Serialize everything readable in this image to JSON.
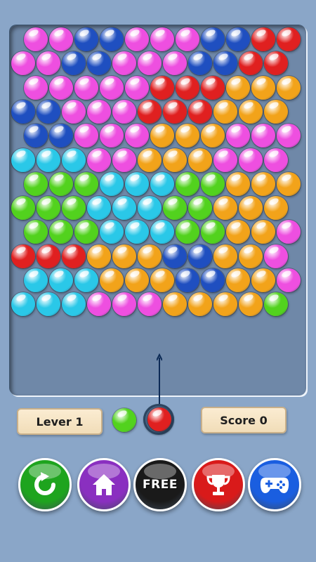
{
  "status_bar": {
    "level_label": "Lever 1",
    "score_label": "Score 0"
  },
  "colors": {
    "pink": "#ee4fe0",
    "blue": "#1f4fc0",
    "red": "#e02020",
    "orange": "#f2a31a",
    "cyan": "#2ac8e8",
    "green": "#52d21e",
    "background": "#8aa6c8",
    "board": "#6f88a8"
  },
  "board": {
    "rows": [
      [
        "P",
        "P",
        "B",
        "B",
        "P",
        "P",
        "P",
        "B",
        "B",
        "R",
        "R"
      ],
      [
        "P",
        "P",
        "B",
        "B",
        "P",
        "P",
        "P",
        "B",
        "B",
        "R",
        "R"
      ],
      [
        "P",
        "P",
        "P",
        "P",
        "P",
        "R",
        "R",
        "R",
        "O",
        "O",
        "O"
      ],
      [
        "B",
        "B",
        "P",
        "P",
        "P",
        "R",
        "R",
        "R",
        "O",
        "O",
        "O"
      ],
      [
        "B",
        "B",
        "P",
        "P",
        "P",
        "O",
        "O",
        "O",
        "P",
        "P",
        "P"
      ],
      [
        "C",
        "C",
        "C",
        "P",
        "P",
        "O",
        "O",
        "O",
        "P",
        "P",
        "P"
      ],
      [
        "G",
        "G",
        "G",
        "C",
        "C",
        "C",
        "G",
        "G",
        "O",
        "O",
        "O"
      ],
      [
        "G",
        "G",
        "G",
        "C",
        "C",
        "C",
        "G",
        "G",
        "O",
        "O",
        "O"
      ],
      [
        "G",
        "G",
        "G",
        "C",
        "C",
        "C",
        "G",
        "G",
        "O",
        "O",
        "P"
      ],
      [
        "R",
        "R",
        "R",
        "O",
        "O",
        "O",
        "B",
        "B",
        "O",
        "O",
        "P"
      ],
      [
        "C",
        "C",
        "C",
        "O",
        "O",
        "O",
        "B",
        "B",
        "O",
        "O",
        "P"
      ],
      [
        "C",
        "C",
        "C",
        "P",
        "P",
        "P",
        "O",
        "O",
        "O",
        "O",
        "G"
      ]
    ]
  },
  "shooter": {
    "current_color": "R",
    "next_color": "G"
  },
  "buttons": {
    "restart": {
      "icon": "restart-icon",
      "color": "#1ea41e"
    },
    "home": {
      "icon": "home-icon",
      "color": "#8a2fc0"
    },
    "free": {
      "label": "FREE",
      "color": "#1a1a1a"
    },
    "trophy": {
      "icon": "trophy-icon",
      "color": "#d91a1a"
    },
    "games": {
      "icon": "gamepad-icon",
      "color": "#1a5ee0"
    }
  }
}
